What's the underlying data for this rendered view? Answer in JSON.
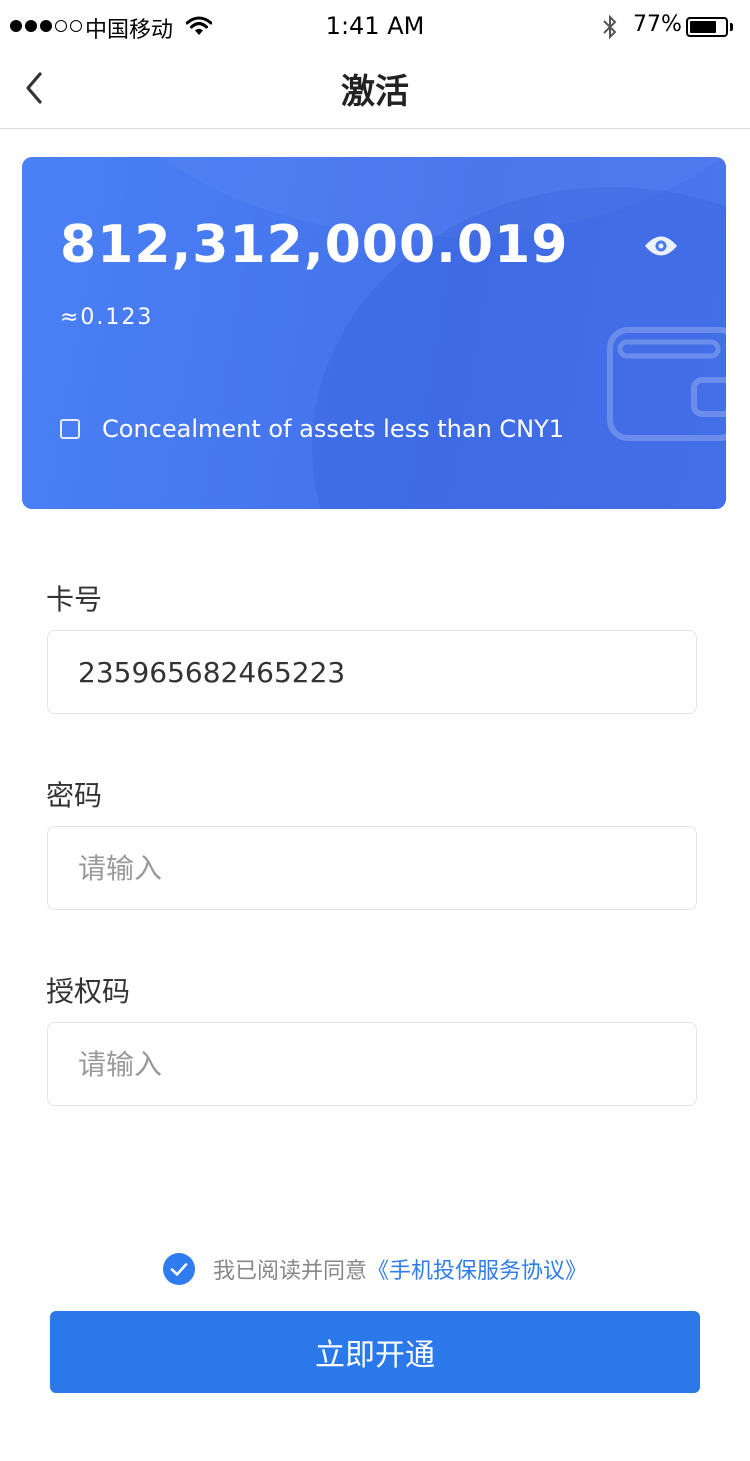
{
  "status_bar": {
    "carrier": "中国移动",
    "time": "1:41 AM",
    "battery_percent": "77%",
    "battery_level": 0.77,
    "icons": [
      "signal-dots-icon",
      "wifi-icon",
      "bluetooth-icon",
      "battery-icon"
    ]
  },
  "nav": {
    "title": "激活",
    "back_icon": "chevron-left-icon"
  },
  "card": {
    "amount": "812,312,000.019",
    "approx": "≈0.123",
    "conceal_label": "Concealment of assets less than CNY1",
    "conceal_checked": false,
    "eye_icon": "eye-icon",
    "background_icon": "wallet-icon",
    "color": "#4a7af0"
  },
  "form": {
    "card_number": {
      "label": "卡号",
      "value": "235965682465223",
      "placeholder": ""
    },
    "password": {
      "label": "密码",
      "value": "",
      "placeholder": "请输入"
    },
    "auth_code": {
      "label": "授权码",
      "value": "",
      "placeholder": "请输入"
    }
  },
  "agreement": {
    "checked": true,
    "text": "我已阅读并同意",
    "link": "《手机投保服务协议》"
  },
  "cta": {
    "label": "立即开通",
    "color": "#2a78ea"
  }
}
